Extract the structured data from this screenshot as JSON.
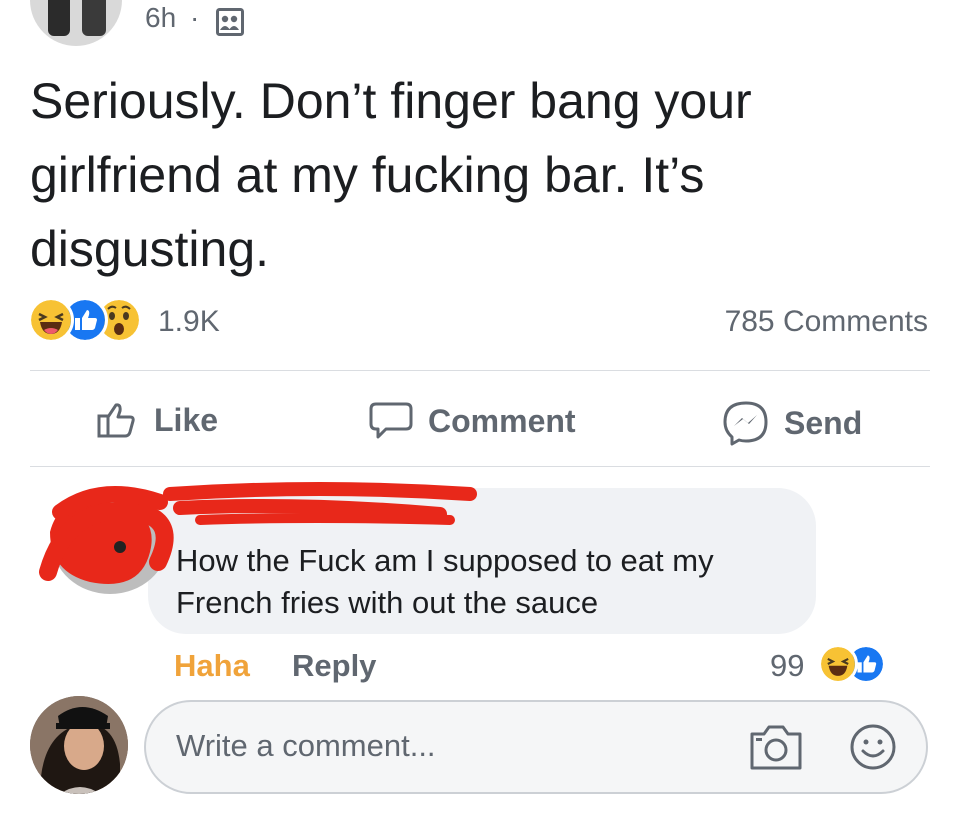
{
  "post": {
    "time": "6h",
    "separator": "·",
    "text": "Seriously. Don’t finger bang your girlfriend at my fucking bar. It’s disgusting.",
    "reaction_count": "1.9K",
    "comment_count": "785 Comments",
    "reaction_icons": [
      "haha-icon",
      "like-icon",
      "wow-icon"
    ]
  },
  "actions": {
    "like": "Like",
    "comment": "Comment",
    "send": "Send"
  },
  "comment": {
    "text": "How the Fuck am I supposed to eat my French fries with out the sauce",
    "reaction_label": "Haha",
    "reply_label": "Reply",
    "reaction_count": "99"
  },
  "composer": {
    "placeholder": "Write a comment..."
  },
  "colors": {
    "haha": "#f0a33a",
    "like_blue": "#1877f2",
    "scribble_red": "#e8281a",
    "secondary_text": "#606770"
  }
}
